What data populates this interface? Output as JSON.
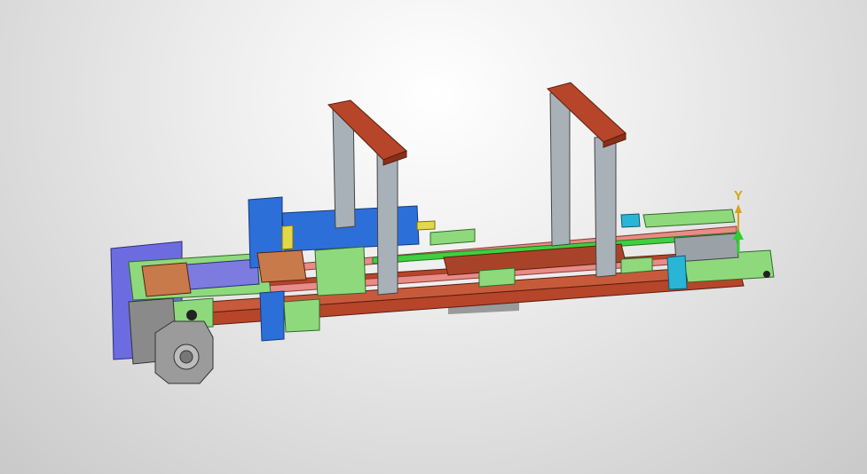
{
  "viewport": {
    "axis_label_y": "Y"
  },
  "colors": {
    "frame_brown": "#b6452a",
    "plate_green": "#8fd97d",
    "motor_blue": "#6c6ce0",
    "cylinder_blue": "#2d6fd9",
    "rail_pink": "#e98b86",
    "rail_green": "#3fcf3f",
    "post_gray": "#a9b1b8",
    "motor_gray": "#8a8a8a",
    "accent_cyan": "#29b6d6",
    "axis_yellow": "#d9a21b"
  }
}
